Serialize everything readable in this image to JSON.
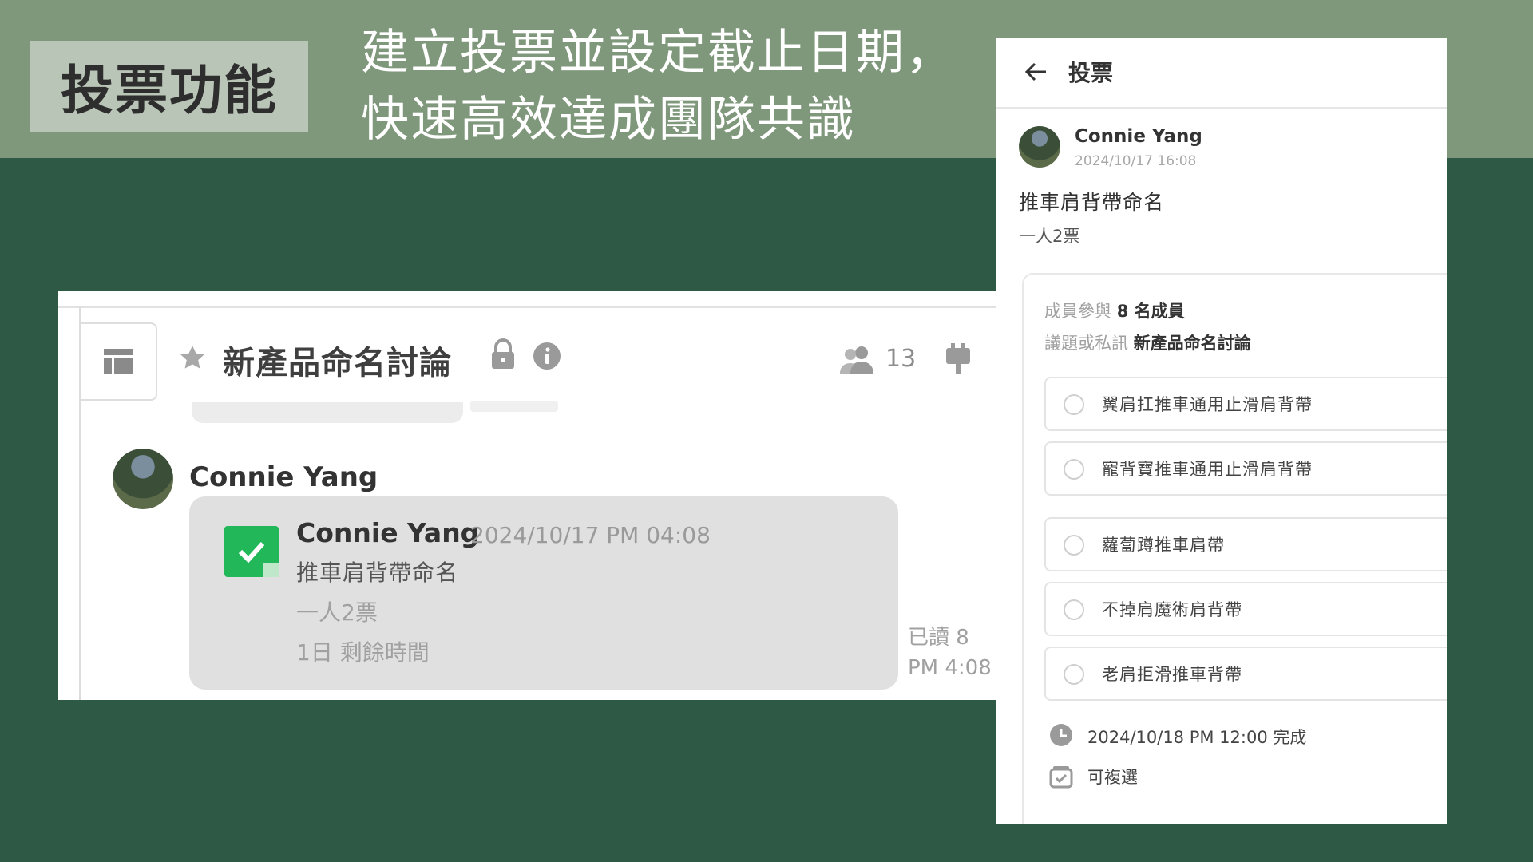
{
  "banner": {
    "badge": "投票功能",
    "headline_line1": "建立投票並設定截止日期，",
    "headline_line2": "快速高效達成團隊共識"
  },
  "chat": {
    "title": "新產品命名討論",
    "member_count": "13",
    "sender_name": "Connie Yang",
    "poll_card": {
      "author": "Connie Yang",
      "time": "2024/10/17 PM 04:08",
      "title": "推車肩背帶命名",
      "rule": "一人2票",
      "remaining": "1日 剩餘時間"
    },
    "read_count": "已讀 8",
    "message_time": "PM 4:08"
  },
  "poll_detail": {
    "header_title": "投票",
    "author": "Connie Yang",
    "time": "2024/10/17 16:08",
    "title": "推車肩背帶命名",
    "rule": "一人2票",
    "participants_label": "成員參與",
    "participants_value": "8 名成員",
    "source_label": "議題或私訊",
    "source_value": "新產品命名討論",
    "options": [
      "翼肩扛推車通用止滑肩背帶",
      "寵背寶推車通用止滑肩背帶",
      "蘿蔔蹲推車肩帶",
      "不掉肩魔術肩背帶",
      "老肩拒滑推車背帶"
    ],
    "deadline": "2024/10/18 PM 12:00 完成",
    "multi_select": "可複選"
  },
  "colors": {
    "background": "#2e5944",
    "top_band": "#7f977b",
    "badge": "#b9c5b6",
    "check_green": "#22b85a"
  }
}
